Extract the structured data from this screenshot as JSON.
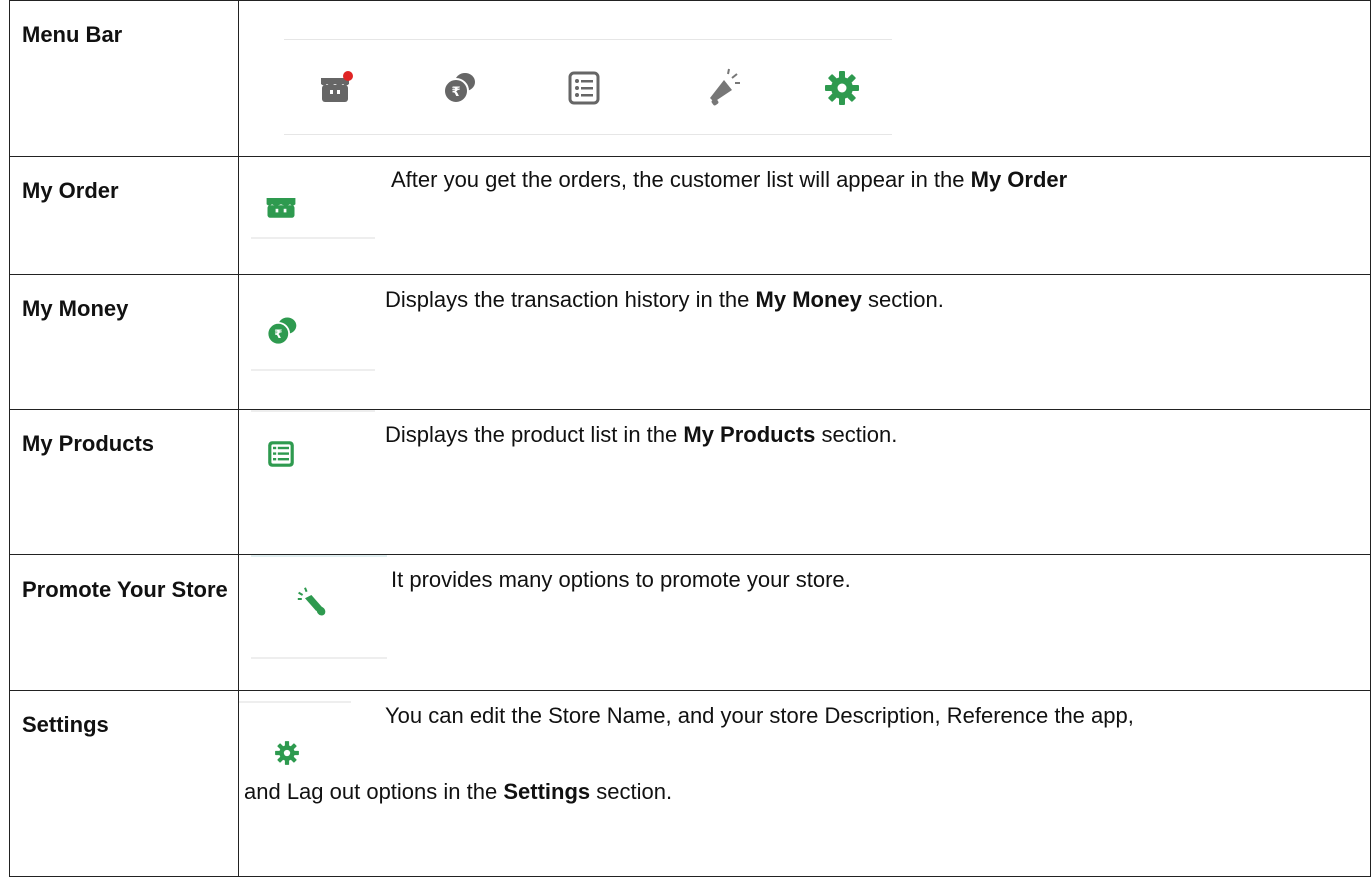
{
  "colors": {
    "green": "#2e9a4f",
    "grey": "#666666",
    "notification": "#e02424",
    "border": "#222222"
  },
  "rows": [
    {
      "label": "Menu Bar"
    },
    {
      "label": "My Order",
      "text_pre": "After you get the orders, the customer list will appear in the ",
      "text_bold": "My Order",
      "text_post": ""
    },
    {
      "label": "My Money",
      "text_pre": "Displays the transaction history in the ",
      "text_bold": "My Money",
      "text_post": " section."
    },
    {
      "label": "My Products",
      "text_pre": "Displays the product list in the ",
      "text_bold": "My Products",
      "text_post": " section."
    },
    {
      "label": "Promote Your Store",
      "text_pre": "It provides many options to promote your store."
    },
    {
      "label": "Settings",
      "line1": "You can edit the Store Name, and your store Description, Reference the app,",
      "line2_pre": "and Lag out options in the ",
      "text_bold": "Settings",
      "line2_post": " section."
    }
  ],
  "icons": {
    "menubar": [
      "store-icon",
      "rupee-coins-icon",
      "list-icon",
      "megaphone-icon",
      "gear-icon"
    ],
    "rows": [
      "store-icon",
      "rupee-coins-icon",
      "list-icon",
      "megaphone-icon",
      "gear-icon"
    ]
  }
}
